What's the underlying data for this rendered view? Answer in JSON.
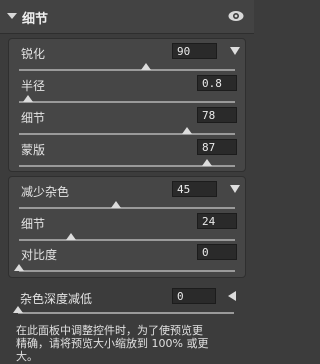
{
  "panel": {
    "title": "细节"
  },
  "sharpen": {
    "amount": {
      "label": "锐化",
      "value": "90",
      "level": 0.59
    },
    "radius": {
      "label": "半径",
      "value": "0.8",
      "level": 0.04
    },
    "detail": {
      "label": "细节",
      "value": "78",
      "level": 0.78
    },
    "masking": {
      "label": "蒙版",
      "value": "87",
      "level": 0.87
    }
  },
  "noise": {
    "reduce": {
      "label": "减少杂色",
      "value": "45",
      "level": 0.45
    },
    "detail": {
      "label": "细节",
      "value": "24",
      "level": 0.24
    },
    "contrast": {
      "label": "对比度",
      "value": "0",
      "level": 0.0
    }
  },
  "color_noise": {
    "label": "杂色深度减低",
    "value": "0",
    "level": 0.0
  },
  "note": {
    "line1": "在此面板中调整控件时，为了使预览更",
    "line2": "精确，请将预览大小缩放到 100% 或更",
    "line3": "大。"
  },
  "icons": {
    "collapse": "triangle-down-icon",
    "visibility": "eye-icon",
    "menu": "triangle-down-icon",
    "reset": "triangle-left-icon"
  },
  "colors": {
    "background": "#3c3c3c",
    "field": "#2a2a2a",
    "text": "#e6e6e6"
  }
}
